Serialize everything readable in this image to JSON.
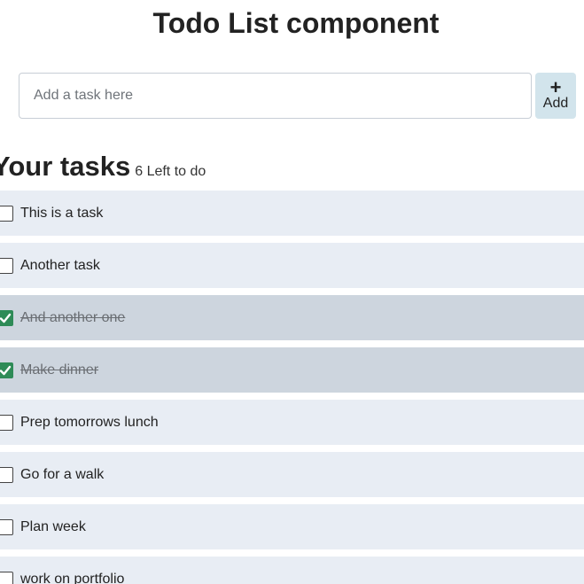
{
  "page": {
    "title": "Todo List component"
  },
  "form": {
    "placeholder": "Add a task here",
    "add_symbol": "+",
    "add_label": "Add"
  },
  "tasks_header": {
    "heading": "Your tasks",
    "count_text": "6 Left to do"
  },
  "tasks": [
    {
      "text": "This is a task",
      "done": false
    },
    {
      "text": "Another task",
      "done": false
    },
    {
      "text": "And another one",
      "done": true
    },
    {
      "text": "Make dinner",
      "done": true
    },
    {
      "text": "Prep tomorrows lunch",
      "done": false
    },
    {
      "text": "Go for a walk",
      "done": false
    },
    {
      "text": "Plan week",
      "done": false
    },
    {
      "text": "work on portfolio",
      "done": false
    }
  ],
  "colors": {
    "row_background": "#e8edf4",
    "row_done_background": "#cdd5de",
    "checkbox_checked": "#2e8b57",
    "add_button": "#d2e4ec"
  },
  "icons": {
    "add": "plus-icon",
    "checked": "check-icon"
  }
}
